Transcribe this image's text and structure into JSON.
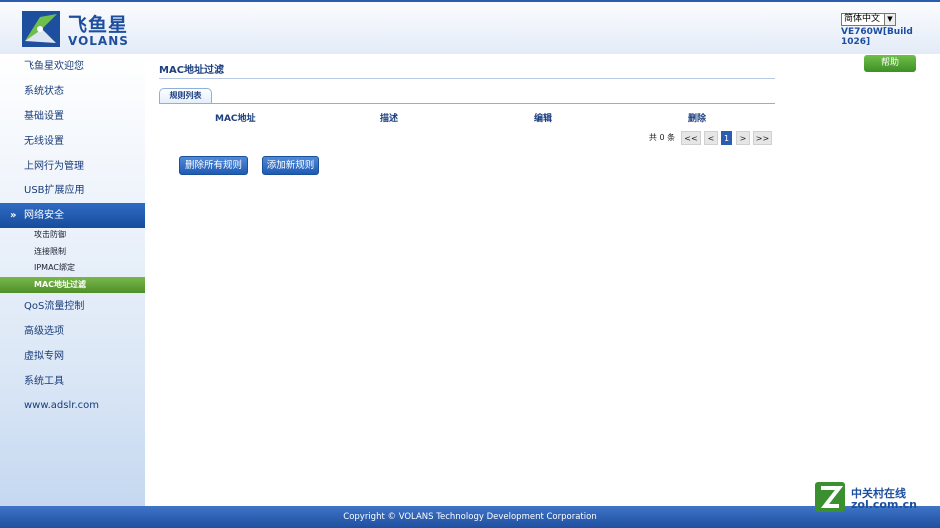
{
  "header": {
    "brand_cn": "飞鱼星",
    "brand_en": "VOLANS",
    "language": "简体中文",
    "build": "VE760W[Build 1026]"
  },
  "sidebar": {
    "items": [
      {
        "label": "飞鱼星欢迎您"
      },
      {
        "label": "系统状态"
      },
      {
        "label": "基础设置"
      },
      {
        "label": "无线设置"
      },
      {
        "label": "上网行为管理"
      },
      {
        "label": "USB扩展应用"
      },
      {
        "label": "网络安全"
      },
      {
        "label": "QoS流量控制"
      },
      {
        "label": "高级选项"
      },
      {
        "label": "虚拟专网"
      },
      {
        "label": "系统工具"
      },
      {
        "label": "www.adslr.com"
      }
    ],
    "subitems": [
      {
        "label": "攻击防御"
      },
      {
        "label": "连接限制"
      },
      {
        "label": "IPMAC绑定"
      },
      {
        "label": "MAC地址过滤"
      }
    ]
  },
  "help_label": "帮助",
  "main": {
    "title": "MAC地址过滤",
    "tab_label": "规则列表",
    "columns": [
      "MAC地址",
      "描述",
      "编辑",
      "删除"
    ],
    "pager": {
      "total": "共 0 条",
      "first": "<<",
      "prev": "<",
      "current": "1",
      "next": ">",
      "last": ">>"
    },
    "buttons": {
      "delete_all": "删除所有规则",
      "add_new": "添加新规则"
    }
  },
  "footer": {
    "copyright": "Copyright © VOLANS Technology Development Corporation"
  },
  "watermark": {
    "line1": "中关村在线",
    "line2": "zol.com.cn"
  },
  "colors": {
    "accent": "#2a5db0",
    "active_sub": "#5a9a32",
    "help": "#4fa02f"
  }
}
